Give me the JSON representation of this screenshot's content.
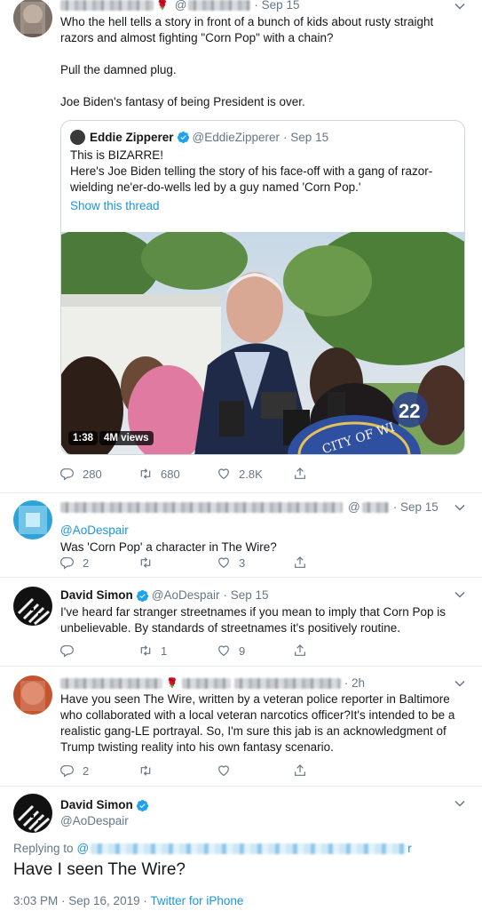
{
  "tweets": {
    "main": {
      "timestamp": "· Sep 15",
      "text": "Who the hell tells a story in front of a bunch of kids about rusty straight razors and almost fighting \"Corn Pop\" with a chain?",
      "text2": "Pull the damned plug.",
      "text3": "Joe Biden's fantasy of being President is over.",
      "actions": {
        "replies": "280",
        "retweets": "680",
        "likes": "2.8K"
      }
    },
    "quoted": {
      "name": "Eddie Zipperer",
      "handle": "@EddieZipperer",
      "date": "· Sep 15",
      "line1": "This is BIZARRE!",
      "line2": "Here's Joe Biden telling the story of his face-off with a gang of razor-wielding ne'er-do-wells led by a guy named 'Corn Pop.'",
      "show_thread": "Show this thread",
      "video": {
        "duration": "1:38",
        "views": "4M views",
        "podium_text": "CITY OF WI",
        "channel": "22"
      }
    },
    "reply1": {
      "timestamp": "· Sep 15",
      "replying_to": "@AoDespair",
      "text": "Was 'Corn Pop' a character in The Wire?",
      "actions": {
        "replies": "2",
        "retweets": "",
        "likes": "3"
      }
    },
    "reply2": {
      "name": "David Simon",
      "handle": "@AoDespair",
      "date": "· Sep 15",
      "text": "I've heard far stranger streetnames if you mean to imply that Corn Pop is unbelievable. By standards of streetnames it's positively routine.",
      "actions": {
        "replies": "",
        "retweets": "1",
        "likes": "9"
      }
    },
    "reply3": {
      "timestamp": "· 2h",
      "text": "Have you seen The Wire, written by a veteran police reporter in Baltimore who collaborated with a local veteran narcotics officer?It's intended to be a realistic gang-LE portrayal. So, I'm sure this jab is an acknowledgment of Trump twisting reality into his own fantasy scenario.",
      "actions": {
        "replies": "2",
        "retweets": "",
        "likes": ""
      }
    },
    "focused": {
      "name": "David Simon",
      "handle": "@AoDespair",
      "replying_to_label": "Replying to",
      "text": "Have I seen The Wire?",
      "time": "3:03 PM · Sep 16, 2019",
      "source": "Twitter for iPhone"
    }
  },
  "colors": {
    "link": "#1b95e0",
    "muted": "#657786",
    "verified": "#1da1f2"
  }
}
